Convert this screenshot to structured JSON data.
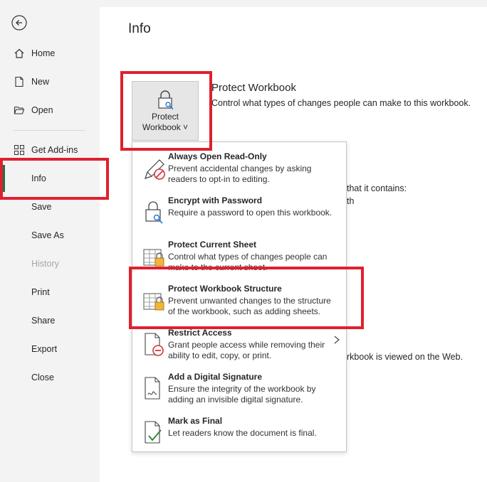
{
  "sidebar": {
    "items": [
      {
        "label": "Home",
        "icon": "home-icon"
      },
      {
        "label": "New",
        "icon": "new-document-icon"
      },
      {
        "label": "Open",
        "icon": "folder-open-icon"
      },
      {
        "label": "Get Add-ins",
        "icon": "grid-icon"
      },
      {
        "label": "Info",
        "active": true
      },
      {
        "label": "Save"
      },
      {
        "label": "Save As"
      },
      {
        "label": "History",
        "disabled": true
      },
      {
        "label": "Print"
      },
      {
        "label": "Share"
      },
      {
        "label": "Export"
      },
      {
        "label": "Close"
      }
    ]
  },
  "page": {
    "title": "Info"
  },
  "protect_button": {
    "label_line1": "Protect",
    "label_line2": "Workbook ˅"
  },
  "section": {
    "title": "Protect Workbook",
    "description": "Control what types of changes people can make to this workbook."
  },
  "background_fragments": {
    "frag1": "that it contains:",
    "frag2": "th",
    "frag3": "rkbook is viewed on the Web."
  },
  "menu": {
    "items": [
      {
        "title": "Always Open Read-Only",
        "desc": "Prevent accidental changes by asking readers to opt-in to editing."
      },
      {
        "title": "Encrypt with Password",
        "desc": "Require a password to open this workbook."
      },
      {
        "title": "Protect Current Sheet",
        "desc": "Control what types of changes people can make to the current sheet."
      },
      {
        "title": "Protect Workbook Structure",
        "desc": "Prevent unwanted changes to the structure of the workbook, such as adding sheets."
      },
      {
        "title": "Restrict Access",
        "desc": "Grant people access while removing their ability to edit, copy, or print.",
        "has_submenu": true
      },
      {
        "title": "Add a Digital Signature",
        "desc": "Ensure the integrity of the workbook by adding an invisible digital signature."
      },
      {
        "title": "Mark as Final",
        "desc": "Let readers know the document is final."
      }
    ]
  },
  "colors": {
    "highlight": "#e0202e",
    "accent": "#1e7145",
    "lock_gold": "#f2b53a"
  }
}
